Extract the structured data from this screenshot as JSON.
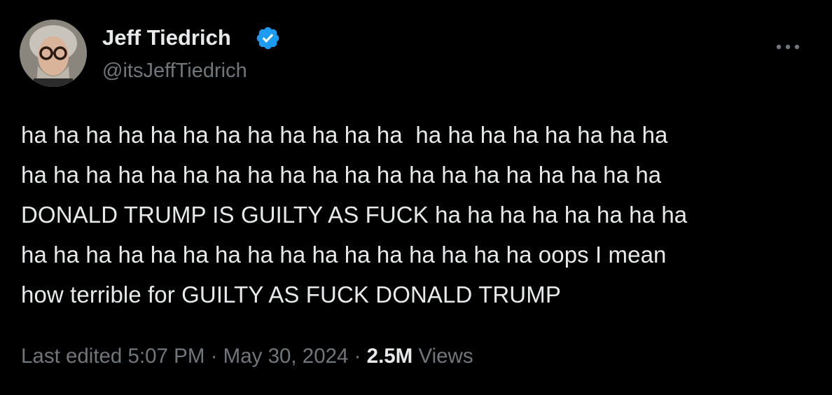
{
  "author": {
    "display_name": "Jeff Tiedrich",
    "handle": "@itsJeffTiedrich",
    "verified": true,
    "verified_color": "#1d9bf0",
    "avatar_icon": "avatar-photo"
  },
  "menu": {
    "icon": "more-icon"
  },
  "tweet": {
    "lines": [
      "ha ha ha ha ha ha ha ha ha ha ha ha  ha ha ha ha ha ha ha ha",
      "ha ha ha ha ha ha ha ha ha ha ha ha ha ha ha ha ha ha ha ha",
      "DONALD TRUMP IS GUILTY AS FUCK ha ha ha ha ha ha ha ha",
      "ha ha ha ha ha ha ha ha ha ha ha ha ha ha ha ha oops I mean",
      "how terrible for GUILTY AS FUCK DONALD TRUMP"
    ]
  },
  "meta": {
    "edited_label": "Last edited",
    "time": "5:07 PM",
    "separator": "·",
    "date": "May 30, 2024",
    "views_count": "2.5M",
    "views_label": "Views"
  },
  "colors": {
    "background": "#000000",
    "primary_text": "#e7e9ea",
    "secondary_text": "#71767b",
    "accent": "#1d9bf0"
  }
}
